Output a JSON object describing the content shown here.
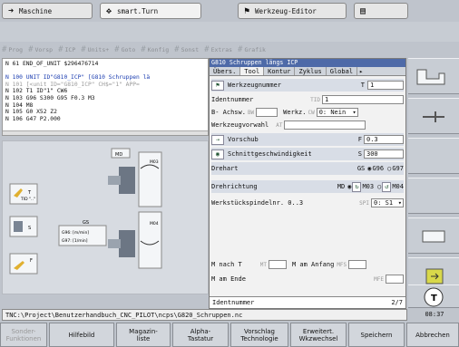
{
  "tabs": [
    {
      "label": "Maschine",
      "icon": "arrow-icon"
    },
    {
      "label": "smart.Turn",
      "icon": "move-icon"
    },
    {
      "label": "Werkzeug-Editor",
      "icon": "tool-icon"
    },
    {
      "label": "",
      "icon": "save-icon"
    }
  ],
  "menubar": [
    "Prog",
    "Vorsp",
    "ICP",
    "Units+",
    "Goto",
    "Konfig",
    "Sonst",
    "Extras",
    "Grafik"
  ],
  "editor": {
    "lines": [
      {
        "text": "N  61 END_OF_UNIT $296476714",
        "cls": ""
      },
      {
        "text": "",
        "cls": ""
      },
      {
        "text": "N 100 UNIT ID\"G810_ICP\" [G810 Schruppen lä",
        "cls": "blue"
      },
      {
        "text": "N 101   [<unit ID=\"G810_ICP\" CH$=\"1\" APP=",
        "cls": "gray"
      },
      {
        "text": "N 102   T1 ID\"1\" CW6",
        "cls": ""
      },
      {
        "text": "N 103   G96 S300 G95 F0.3 M3",
        "cls": ""
      },
      {
        "text": "N 104   M8",
        "cls": ""
      },
      {
        "text": "N 105   G0 X52 Z2",
        "cls": ""
      },
      {
        "text": "N 106   G47 P2.000",
        "cls": ""
      }
    ]
  },
  "graphic": {
    "md": "MD",
    "m03": "M03",
    "m04": "M04",
    "gs": "GS",
    "g96": "G96: [m/min]",
    "g97": "G97: [1/min]",
    "t": "T",
    "tid": "TID \"..\"",
    "s": "S",
    "f": "F"
  },
  "dialog": {
    "title": "G810 Schruppen längs ICP",
    "tabs": [
      "Übers.",
      "Tool",
      "Kontur",
      "Zyklus",
      "Global"
    ],
    "werkzeugnummer_label": "Werkzeugnummer",
    "t_label": "T",
    "t_value": "1",
    "identnummer_label": "Identnummer",
    "tid_label": "TID",
    "tid_value": "1",
    "b_achse_label": "B- Achsw.",
    "bw_label": "BW",
    "bw_value": "",
    "werkz_label": "Werkz.",
    "cw_label": "CW",
    "cw_value": "0: Nein",
    "werkzeugvorwahl_label": "Werkzeugvorwahl",
    "at_label": "AT",
    "at_value": "",
    "vorschub_label": "Vorschub",
    "f_label": "F",
    "f_value": "0.3",
    "schnitt_label": "Schnittgeschwindigkeit",
    "s_label": "S",
    "s_value": "300",
    "drehart_label": "Drehart",
    "gs_label": "GS",
    "g96": "G96",
    "g97": "G97",
    "drehrichtung_label": "Drehrichtung",
    "md_label": "MD",
    "m03": "M03",
    "m04": "M04",
    "spindel_label": "Werkstückspindelnr. 0..3",
    "spi_label": "SPI",
    "spi_value": "0: S1",
    "m_nach_t": "M nach T",
    "mt_label": "MT",
    "m_am_anfang": "M am Anfang",
    "mfs_label": "MFS",
    "m_am_ende": "M am Ende",
    "mfe_label": "MFE",
    "footer_label": "Identnummer",
    "footer_page": "2/7"
  },
  "status": {
    "path": "TNC:\\Project\\Benutzerhandbuch_CNC_PILOT\\ncps\\G820_Schruppen.nc",
    "time": "08:37"
  },
  "softkeys": [
    {
      "label": "Sonder-\nFunktionen",
      "disabled": true
    },
    {
      "label": "Hilfebild",
      "disabled": false
    },
    {
      "label": "Magazin-\nliste",
      "disabled": false
    },
    {
      "label": "Alpha-\nTastatur",
      "disabled": false
    },
    {
      "label": "Vorschlag\nTechnologie",
      "disabled": false
    },
    {
      "label": "Erweitert.\nWkzwechsel",
      "disabled": false
    },
    {
      "label": "Speichern",
      "disabled": false
    },
    {
      "label": "Abbrechen",
      "disabled": false
    }
  ]
}
